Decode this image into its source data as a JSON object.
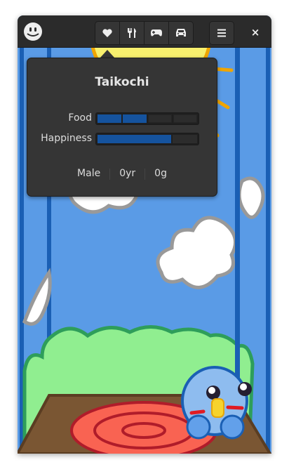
{
  "header": {
    "logo_icon": "smiley-face-icon",
    "buttons": [
      {
        "name": "status",
        "icon": "heart-icon"
      },
      {
        "name": "feed",
        "icon": "fork-knife-icon"
      },
      {
        "name": "play",
        "icon": "gamepad-icon"
      },
      {
        "name": "travel",
        "icon": "car-icon"
      }
    ],
    "menu_icon": "hamburger-menu-icon",
    "close_label": "×"
  },
  "popover": {
    "name": "Taikochi",
    "food_label": "Food",
    "food_level": {
      "filled": 2,
      "total": 4
    },
    "happiness_label": "Happiness",
    "happiness_fraction": 0.75,
    "gender": "Male",
    "age": "0yr",
    "weight": "0g"
  },
  "colors": {
    "accent": "#15539e",
    "header": "#2b2b2b",
    "sky": "#5a9be6",
    "grass": "#90ee90",
    "floor": "#7a5633",
    "rug": "#f96352",
    "pet": "#8ebcef"
  }
}
